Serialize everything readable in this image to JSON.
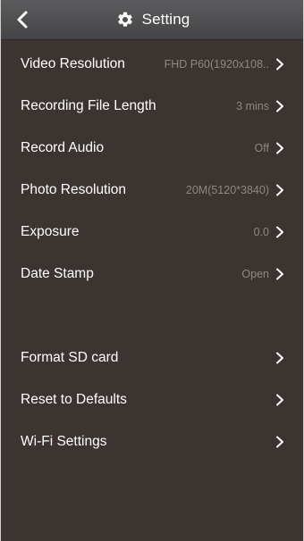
{
  "header": {
    "title": "Setting",
    "back_icon": "chevron-left-icon",
    "title_icon": "gear-icon"
  },
  "settings": {
    "video_resolution": {
      "label": "Video Resolution",
      "value": "FHD P60(1920x108.."
    },
    "recording_file_length": {
      "label": "Recording File Length",
      "value": "3 mins"
    },
    "record_audio": {
      "label": "Record Audio",
      "value": "Off"
    },
    "photo_resolution": {
      "label": "Photo Resolution",
      "value": "20M(5120*3840)"
    },
    "exposure": {
      "label": "Exposure",
      "value": "0.0"
    },
    "date_stamp": {
      "label": "Date Stamp",
      "value": "Open"
    }
  },
  "actions": {
    "format_sd": {
      "label": "Format SD card"
    },
    "reset_defaults": {
      "label": "Reset to Defaults"
    },
    "wifi_settings": {
      "label": "Wi-Fi Settings"
    }
  },
  "colors": {
    "header_background": "#4f4f51",
    "content_background": "#3c3431",
    "label_text": "#ffffff",
    "value_text": "#8e8784"
  }
}
